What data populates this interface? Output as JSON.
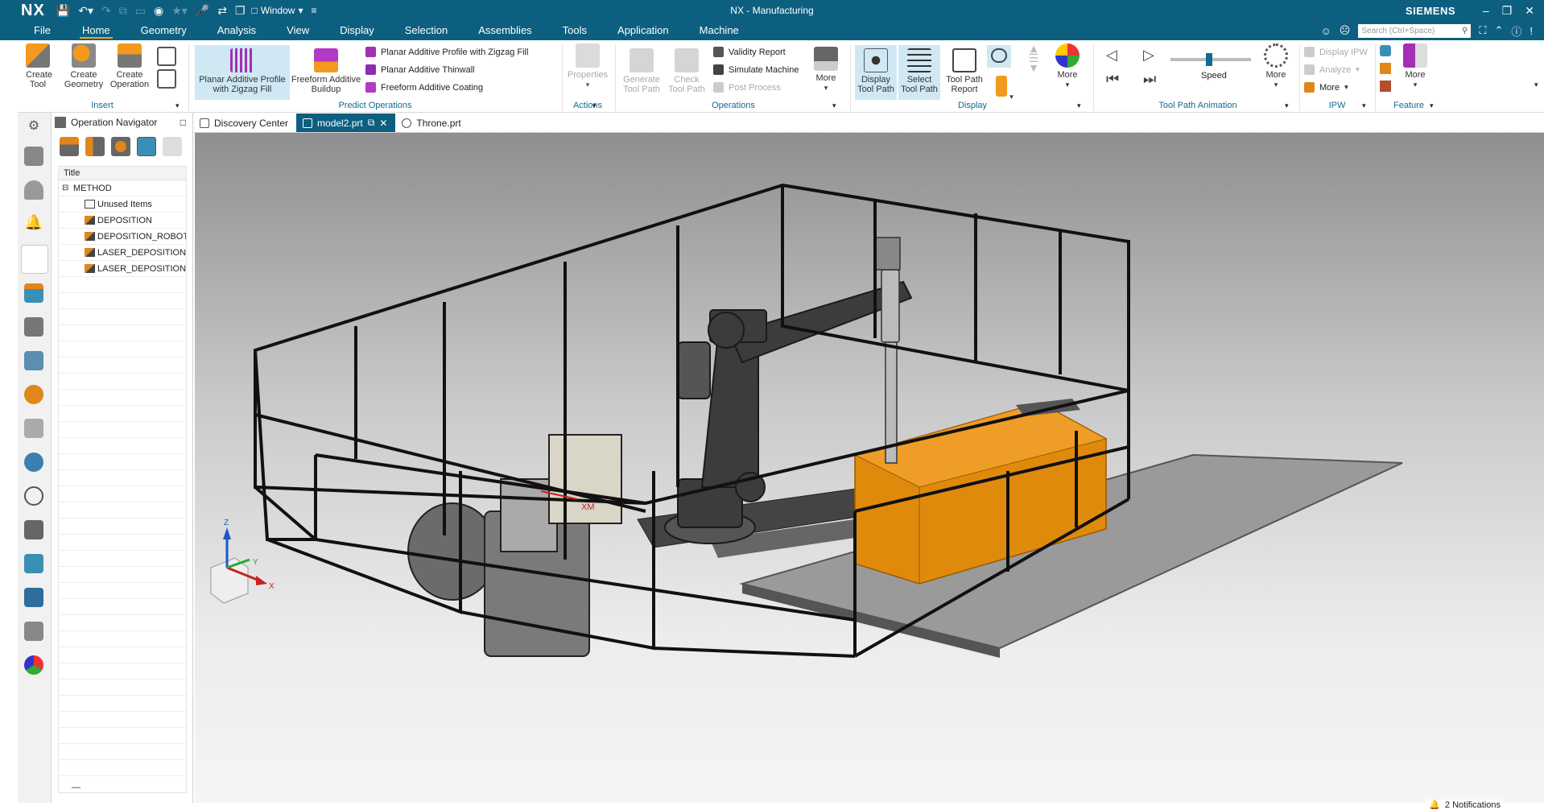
{
  "app": {
    "logo": "NX",
    "title": "NX - Manufacturing",
    "brand": "SIEMENS",
    "window_menu": "Window"
  },
  "menu": {
    "tabs": [
      "File",
      "Home",
      "Geometry",
      "Analysis",
      "View",
      "Display",
      "Selection",
      "Assemblies",
      "Tools",
      "Application",
      "Machine"
    ],
    "active": "Home",
    "search_placeholder": "Search (Ctrl+Space)"
  },
  "ribbon": {
    "insert": {
      "create_tool": "Create Tool",
      "create_geometry": "Create Geometry",
      "create_operation": "Create Operation",
      "group": "Insert"
    },
    "predict": {
      "planar_zigzag": "Planar Additive Profile with Zigzag Fill",
      "freeform_buildup": "Freeform Additive Buildup",
      "list_zigzag": "Planar Additive Profile with Zigzag Fill",
      "list_thinwall": "Planar Additive Thinwall",
      "list_coating": "Freeform Additive Coating",
      "group": "Predict Operations"
    },
    "actions": {
      "properties": "Properties",
      "group": "Actions"
    },
    "operations": {
      "generate": "Generate Tool Path",
      "check": "Check Tool Path",
      "validity": "Validity Report",
      "simulate": "Simulate Machine",
      "post": "Post Process",
      "more": "More",
      "group": "Operations"
    },
    "display": {
      "display_tp": "Display Tool Path",
      "select_tp": "Select Tool Path",
      "tp_report": "Tool Path Report",
      "more": "More",
      "group": "Display"
    },
    "animation": {
      "speed": "Speed",
      "more": "More",
      "group": "Tool Path Animation"
    },
    "ipw": {
      "display_ipw": "Display IPW",
      "analyze": "Analyze",
      "more": "More",
      "group": "IPW"
    },
    "feature": {
      "more": "More",
      "group": "Feature"
    }
  },
  "navigator": {
    "title": "Operation Navigator",
    "column": "Title",
    "rows": [
      {
        "label": "METHOD",
        "level": 0,
        "icon": "minus"
      },
      {
        "label": "Unused Items",
        "level": 2,
        "icon": "folder"
      },
      {
        "label": "DEPOSITION",
        "level": 2,
        "icon": "op"
      },
      {
        "label": "DEPOSITION_ROBOT",
        "level": 2,
        "icon": "op"
      },
      {
        "label": "LASER_DEPOSITION",
        "level": 2,
        "icon": "op"
      },
      {
        "label": "LASER_DEPOSITION",
        "level": 2,
        "icon": "op"
      }
    ],
    "footer": "—"
  },
  "doc_tabs": [
    {
      "label": "Discovery Center",
      "active": false
    },
    {
      "label": "model2.prt",
      "active": true
    },
    {
      "label": "Throne.prt",
      "active": false
    }
  ],
  "viewport": {
    "wcs_label": "XM",
    "axis_x": "X",
    "axis_y": "Y",
    "axis_z": "Z"
  },
  "status": {
    "notifications": "2 Notifications"
  },
  "colors": {
    "titlebar": "#0d5f80",
    "accent": "#f2a020",
    "part": "#e08a0c",
    "ribbon_group": "#0e6c92"
  }
}
